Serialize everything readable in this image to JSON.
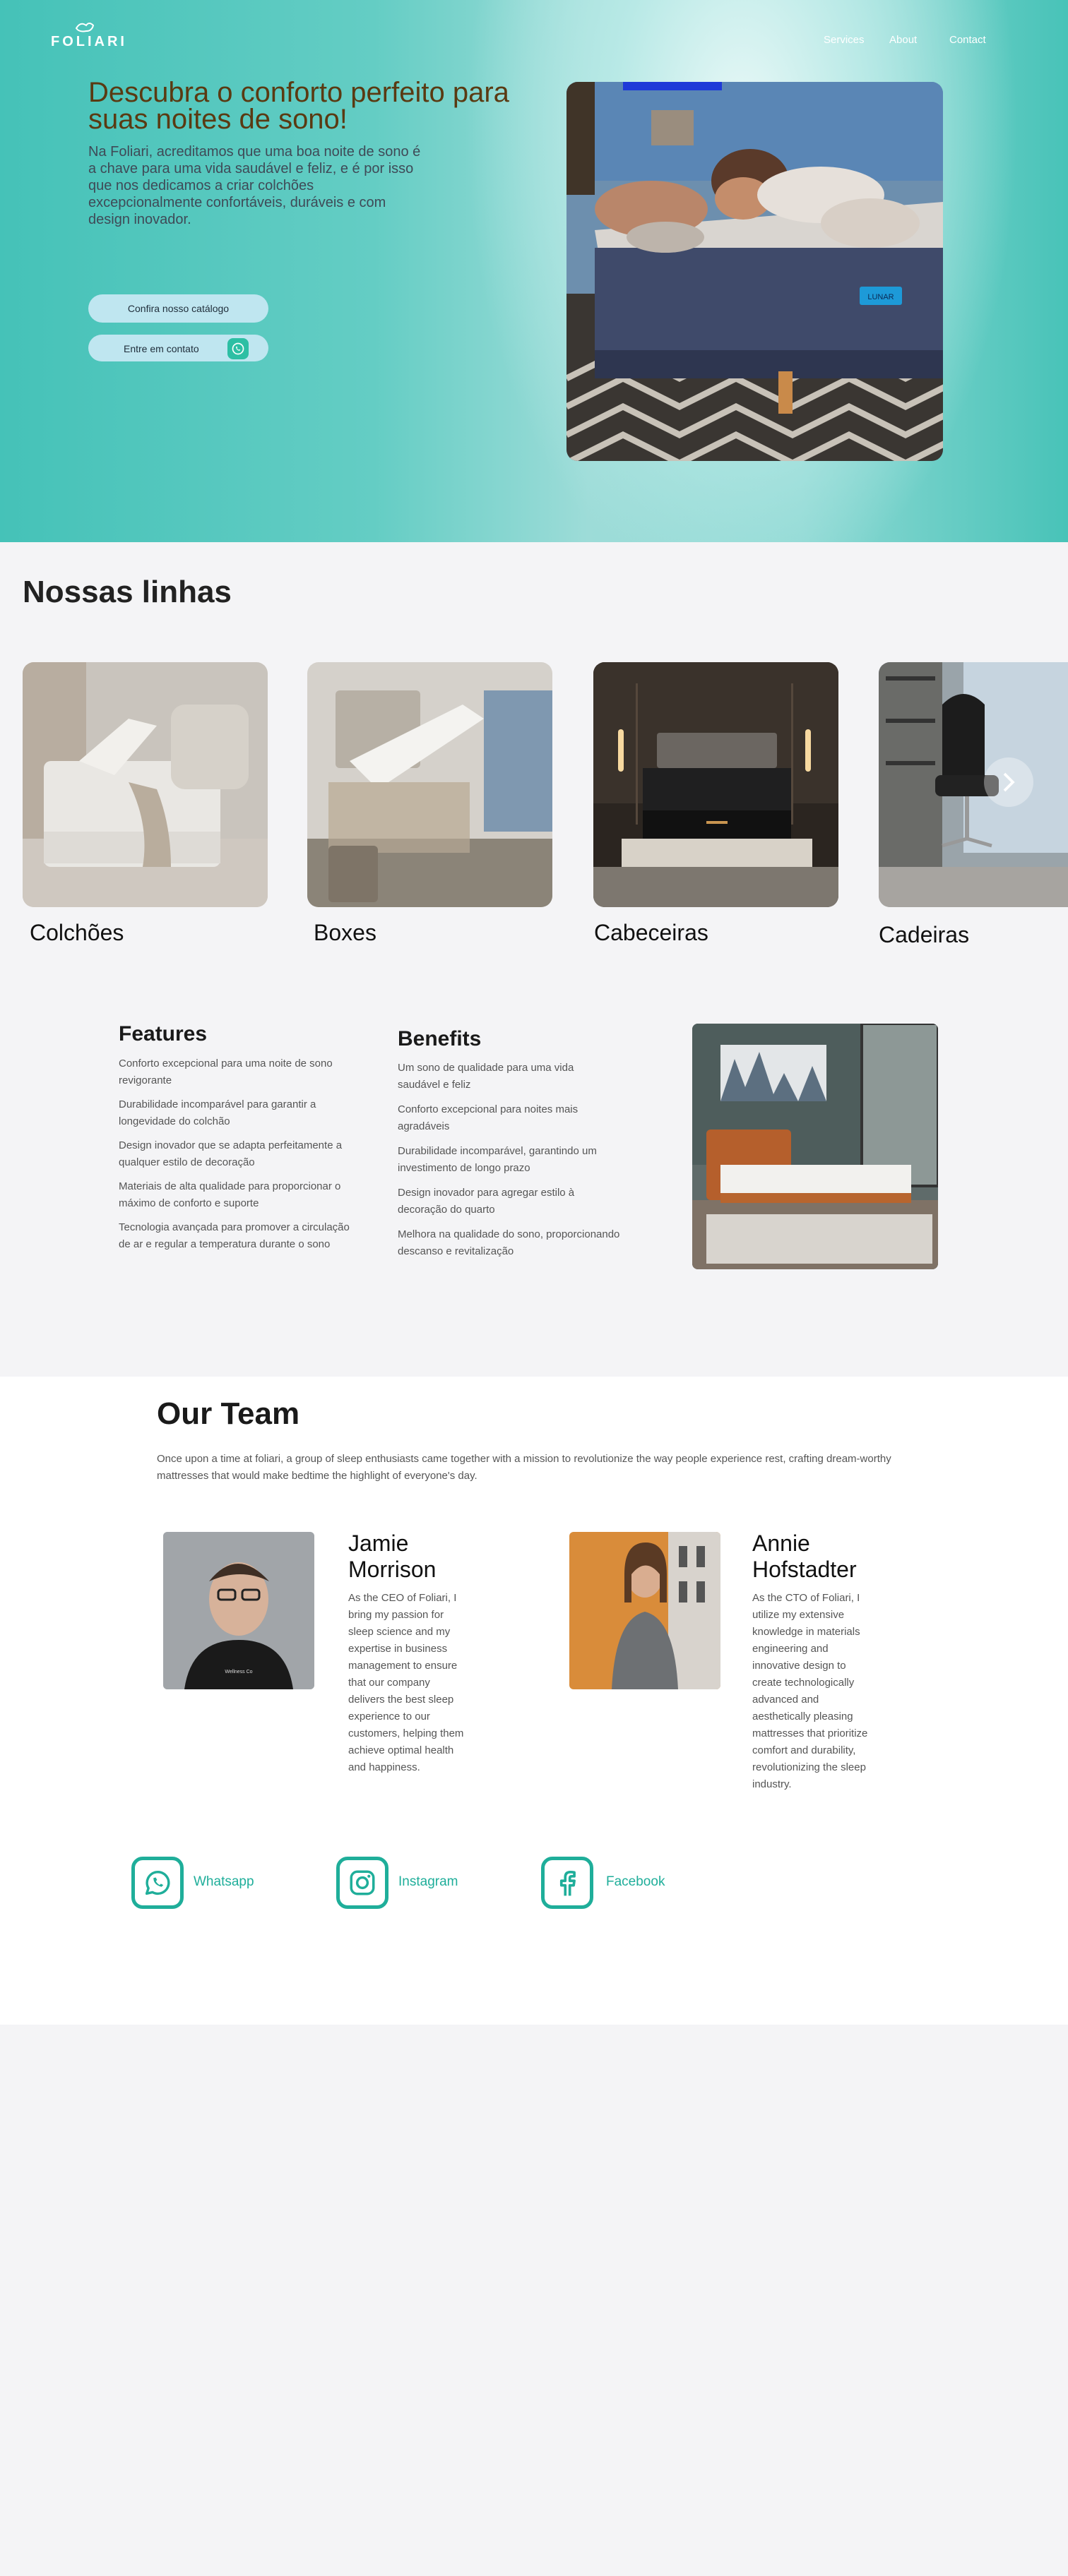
{
  "header": {
    "logo_text": "FOLIARI",
    "nav": [
      "Services",
      "About",
      "Contact"
    ]
  },
  "hero": {
    "title": "Descubra o conforto perfeito para suas noites de sono!",
    "text": "Na Foliari, acreditamos que uma boa noite de sono é a chave para uma vida saudável e feliz, e é por isso que nos dedicamos a criar colchões excepcionalmente confortáveis, duráveis e com design inovador.",
    "catalog_button": "Confira nosso catálogo",
    "contact_button": "Entre em contato",
    "photo_tag": "LUNAR"
  },
  "lines": {
    "title": "Nossas linhas",
    "items": [
      "Colchões",
      "Boxes",
      "Cabeceiras",
      "Cadeiras"
    ]
  },
  "features": {
    "title": "Features",
    "items": [
      "Conforto excepcional para uma noite de sono revigorante",
      "Durabilidade incomparável para garantir a longevidade do colchão",
      "Design inovador que se adapta perfeitamente a qualquer estilo de decoração",
      "Materiais de alta qualidade para proporcionar o máximo de conforto e suporte",
      "Tecnologia avançada para promover a circulação de ar e regular a temperatura durante o sono"
    ]
  },
  "benefits": {
    "title": "Benefits",
    "items": [
      "Um sono de qualidade para uma vida saudável e feliz",
      "Conforto excepcional para noites mais agradáveis",
      "Durabilidade incomparável, garantindo um investimento de longo prazo",
      "Design inovador para agregar estilo à decoração do quarto",
      "Melhora na qualidade do sono, proporcionando descanso e revitalização"
    ]
  },
  "team": {
    "title": "Our Team",
    "intro": "Once upon a time at foliari, a group of sleep enthusiasts came together with a mission to revolutionize the way people experience rest, crafting dream-worthy mattresses that would make bedtime the highlight of everyone's day.",
    "members": [
      {
        "name": "Jamie Morrison",
        "bio": "As the CEO of Foliari, I bring my passion for sleep science and my expertise in business management to ensure that our company delivers the best sleep experience to our customers, helping them achieve optimal health and happiness.",
        "shirt_text": "Wellness Co"
      },
      {
        "name": "Annie Hofstadter",
        "bio": "As the CTO of Foliari, I utilize my extensive knowledge in materials engineering and innovative design to create technologically advanced and aesthetically pleasing mattresses that prioritize comfort and durability, revolutionizing the sleep industry."
      }
    ]
  },
  "social": [
    "Whatsapp",
    "Instagram",
    "Facebook"
  ],
  "colors": {
    "accent": "#1fae9a",
    "hero_title": "#5a3a12",
    "button_bg": "#bfe6f0",
    "hero_gradient_start": "#45c2b8"
  }
}
